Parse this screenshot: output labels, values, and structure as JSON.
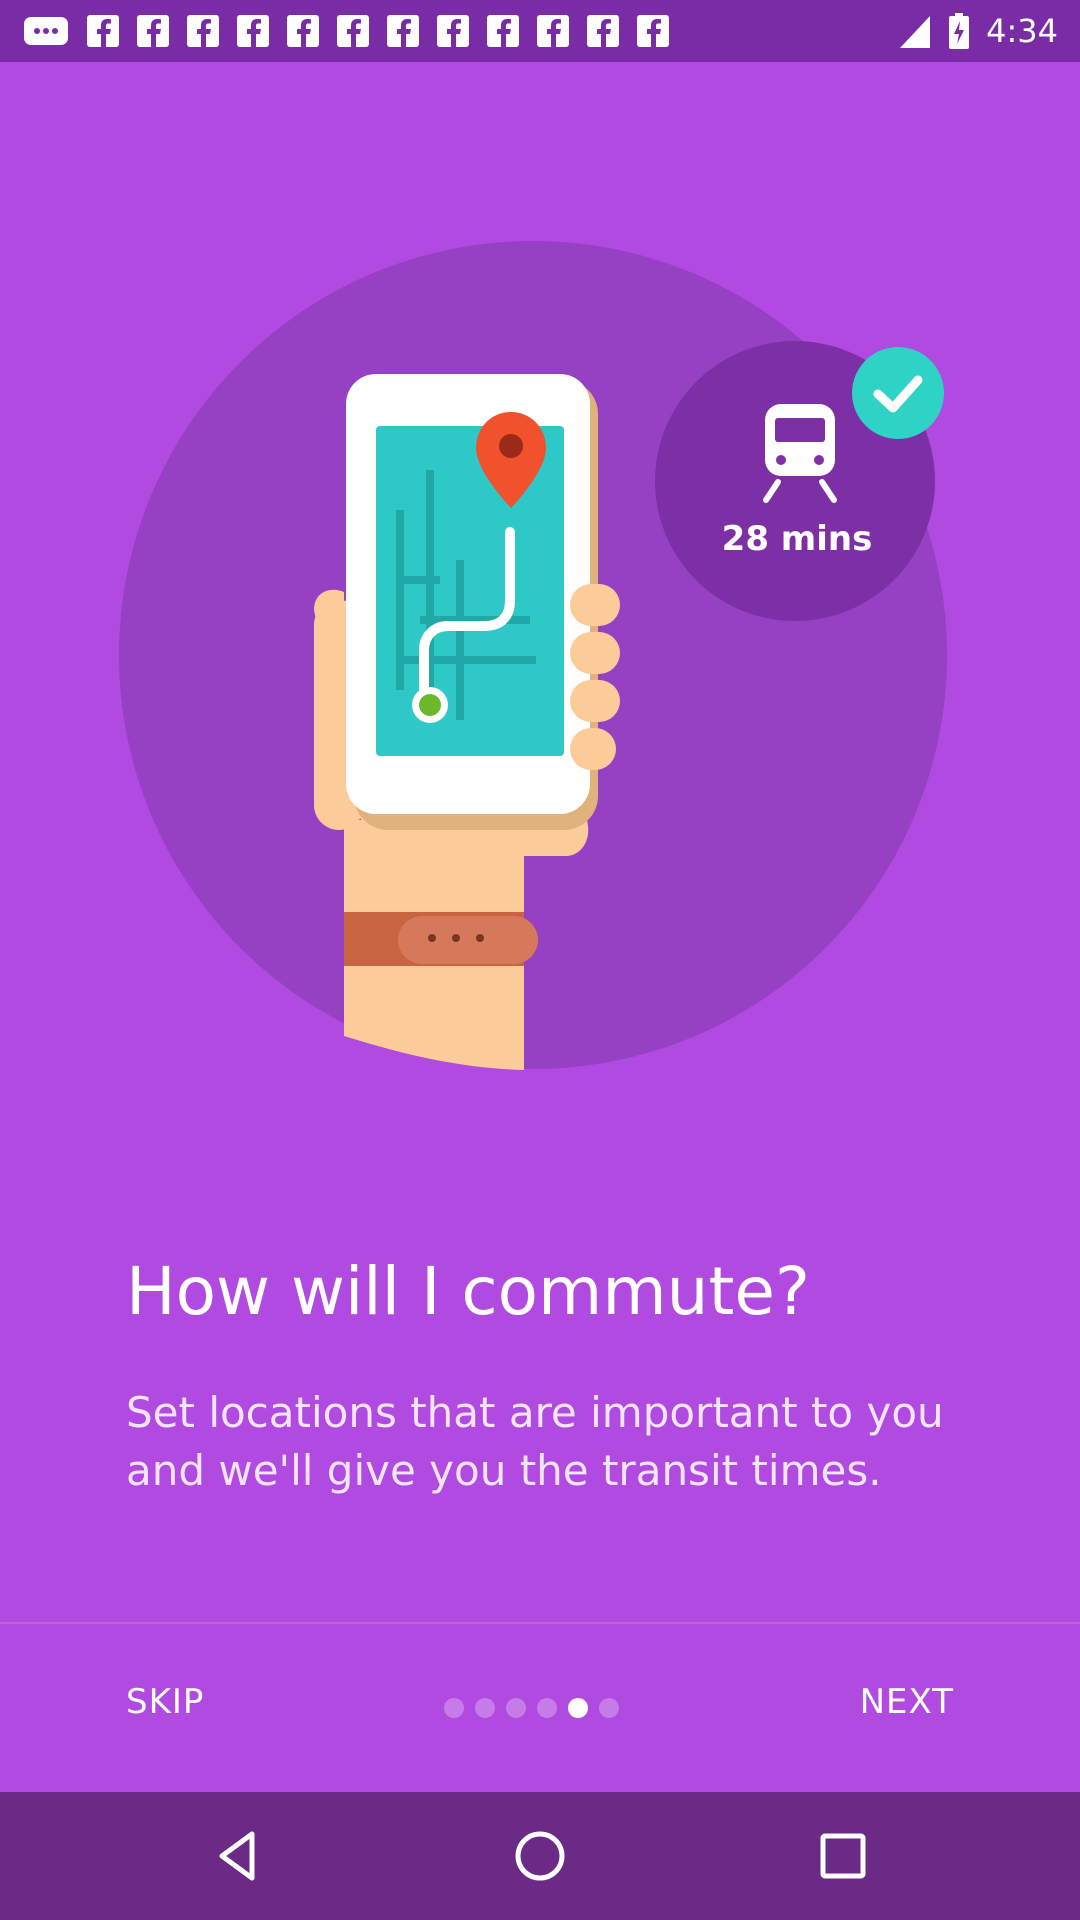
{
  "status_bar": {
    "time": "4:34",
    "notification_icons": [
      "messaging-icon",
      "facebook-icon",
      "facebook-icon",
      "facebook-icon",
      "facebook-icon",
      "facebook-icon",
      "facebook-icon",
      "facebook-icon",
      "facebook-icon",
      "facebook-icon",
      "facebook-icon",
      "facebook-icon"
    ],
    "system_icons": [
      "signal-icon",
      "battery-charging-icon"
    ]
  },
  "illustration": {
    "transit_time": "28 mins",
    "colors": {
      "circle": "#9640c4",
      "phone_screen": "#2ec9c6",
      "pin": "#f0522d",
      "check_badge": "#2ed3c6",
      "skin": "#fbcb9a",
      "strap": "#c86540"
    }
  },
  "onboarding": {
    "title": "How will I commute?",
    "subtitle": "Set locations that are important to you and we'll give you the transit times.",
    "skip_label": "SKIP",
    "next_label": "NEXT",
    "page_count": 6,
    "current_page": 5
  },
  "system_nav": [
    "back-icon",
    "home-icon",
    "recents-icon"
  ],
  "colors": {
    "background": "#b04ae0",
    "status_bar": "#7a2ca7",
    "nav_bar": "#6a2a85"
  }
}
